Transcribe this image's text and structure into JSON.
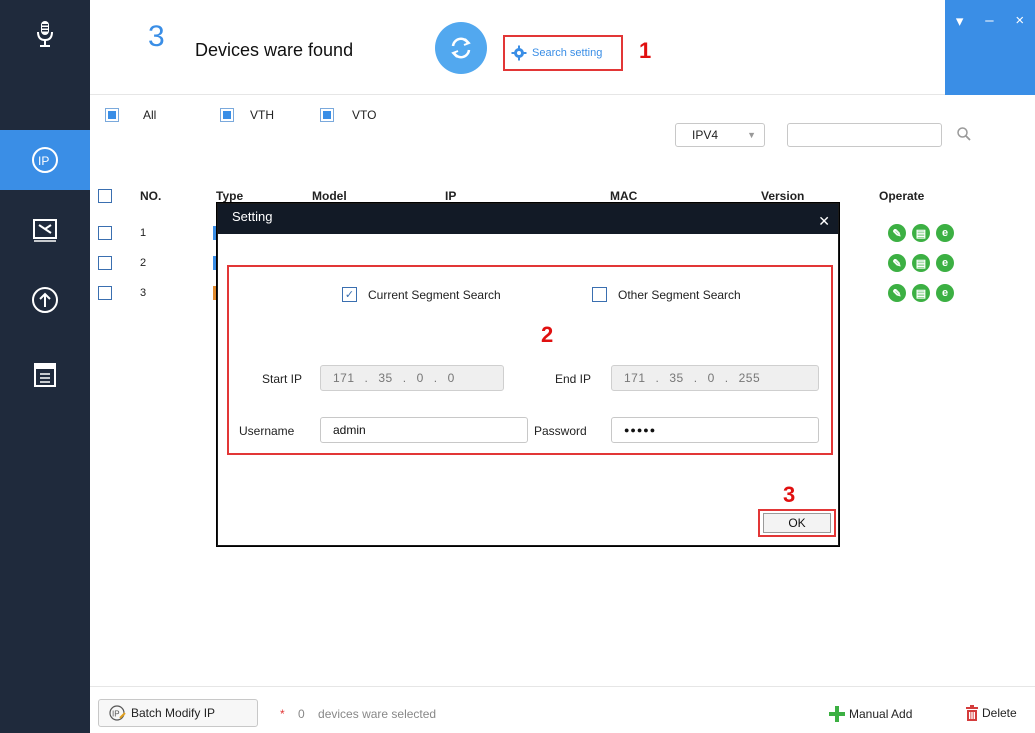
{
  "header": {
    "device_count": "3",
    "found_label": "Devices ware found",
    "search_setting_label": "Search setting",
    "annotation_1": "1"
  },
  "window_controls": {
    "menu": "▾",
    "minimize": "–",
    "close": "×"
  },
  "filters": {
    "all_label": "All",
    "vth_label": "VTH",
    "vto_label": "VTO",
    "ip_version": "IPV4",
    "search_value": ""
  },
  "table": {
    "columns": [
      "NO.",
      "Type",
      "Model",
      "IP",
      "MAC",
      "Version",
      "Operate"
    ],
    "rows": [
      {
        "no": "1",
        "type_color": "#3a8ee6"
      },
      {
        "no": "2",
        "type_color": "#3a8ee6"
      },
      {
        "no": "3",
        "type_color": "#e08a2e"
      }
    ]
  },
  "dialog": {
    "title": "Setting",
    "current_segment_label": "Current Segment Search",
    "current_segment_checked": true,
    "other_segment_label": "Other Segment Search",
    "other_segment_checked": false,
    "annotation_2": "2",
    "start_ip_label": "Start IP",
    "start_ip": [
      "171",
      "35",
      "0",
      "0"
    ],
    "end_ip_label": "End IP",
    "end_ip": [
      "171",
      "35",
      "0",
      "255"
    ],
    "username_label": "Username",
    "username_value": "admin",
    "password_label": "Password",
    "password_value": "●●●●●",
    "annotation_3": "3",
    "ok_label": "OK"
  },
  "footer": {
    "batch_modify_label": "Batch Modify IP",
    "asterisk": "*",
    "selected_count": "0",
    "selected_label": "devices ware selected",
    "manual_add_label": "Manual Add",
    "delete_label": "Delete"
  },
  "colors": {
    "accent": "#3a8ee6",
    "sidebar": "#1f2a3c",
    "annotation_red": "#e23636",
    "operate_green": "#3cb043"
  }
}
